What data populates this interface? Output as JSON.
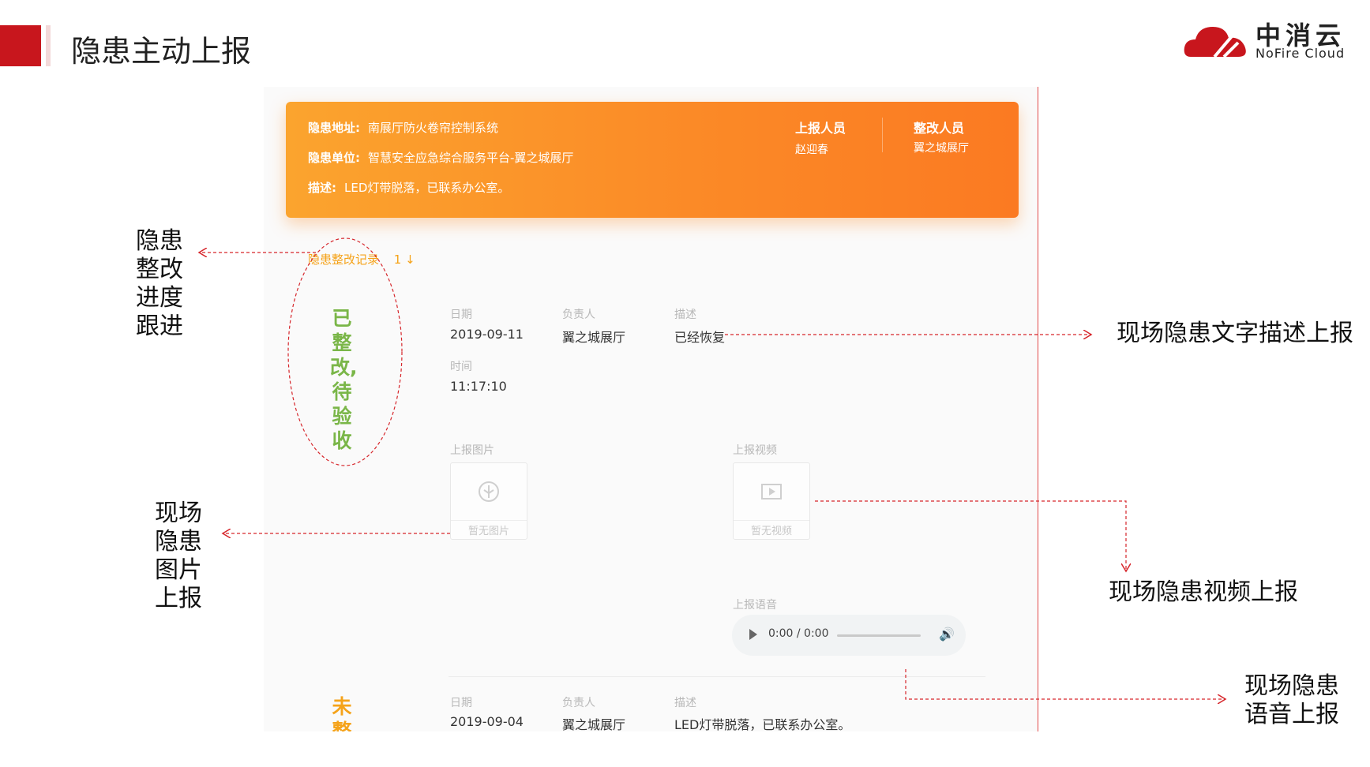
{
  "slide": {
    "title": "隐患主动上报",
    "logo_cn": "中消云",
    "logo_en": "NoFire Cloud",
    "accent": "#c8161d"
  },
  "card": {
    "address_label": "隐患地址:",
    "address_value": "南展厅防火卷帘控制系统",
    "unit_label": "隐患单位:",
    "unit_value": "智慧安全应急综合服务平台-翼之城展厅",
    "desc_label": "描述:",
    "desc_value": "LED灯带脱落，已联系办公室。",
    "reporter_head": "上报人员",
    "reporter_value": "赵迎春",
    "rectifier_head": "整改人员",
    "rectifier_value": "翼之城展厅"
  },
  "records": {
    "title": "隐患整改记录",
    "count": "1 ↓",
    "items": [
      {
        "status": "已整改,待验收",
        "date_label": "日期",
        "date": "2019-09-11",
        "owner_label": "负责人",
        "owner": "翼之城展厅",
        "desc_label": "描述",
        "desc": "已经恢复",
        "time_label": "时间",
        "time": "11:17:10",
        "image_label": "上报图片",
        "image_empty": "暂无图片",
        "video_label": "上报视频",
        "video_empty": "暂无视频",
        "audio_label": "上报语音",
        "audio_time": "0:00 / 0:00"
      },
      {
        "status": "未整",
        "date_label": "日期",
        "date": "2019-09-04",
        "owner_label": "负责人",
        "owner": "翼之城展厅",
        "desc_label": "描述",
        "desc": "LED灯带脱落，已联系办公室。"
      }
    ]
  },
  "annotations": {
    "progress": "隐患整改进度跟进",
    "text_report": "现场隐患文字描述上报",
    "image_report": "现场隐患图片上报",
    "video_report": "现场隐患视频上报",
    "audio_report": "现场隐患语音上报"
  }
}
